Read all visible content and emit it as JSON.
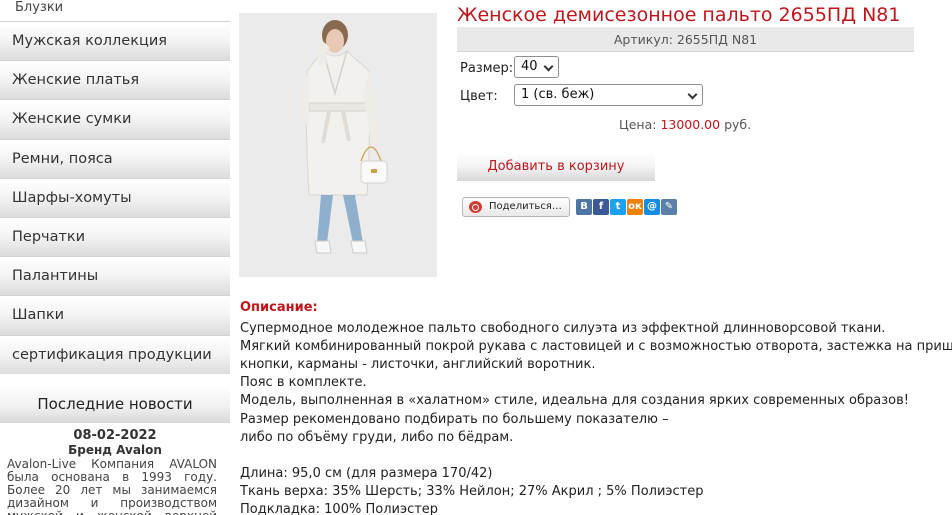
{
  "sidebar": {
    "prev_item": "Блузки",
    "items": [
      {
        "label": "Мужская коллекция"
      },
      {
        "label": "Женские платья"
      },
      {
        "label": "Женские сумки"
      },
      {
        "label": "Ремни, пояса"
      },
      {
        "label": "Шарфы-хомуты"
      },
      {
        "label": "Перчатки"
      },
      {
        "label": "Палантины"
      },
      {
        "label": "Шапки"
      },
      {
        "label": "сертификация продукции"
      }
    ],
    "news": {
      "heading": "Последние новости",
      "date": "08-02-2022",
      "title": "Бренд Avalon",
      "text": "Avalon-Live Компания AVALON была основана в 1993 году. Более 20 лет мы занимаемся дизайном и производством мужской и женской верхней одежды."
    }
  },
  "product": {
    "title": "Женское демисезонное пальто 2655ПД N81",
    "sku": "Артикул: 2655ПД N81",
    "size_label": "Размер:",
    "size_value": "40",
    "color_label": "Цвет:",
    "color_value": "1 (св. беж)",
    "price_label": "Цена:",
    "price_value": "13000.00",
    "price_currency": "руб.",
    "cart_button": "Добавить в корзину",
    "share_button": "Поделиться…",
    "social_icons": [
      {
        "name": "vk-icon",
        "glyph": "В",
        "color": "#4c75a3"
      },
      {
        "name": "facebook-icon",
        "glyph": "f",
        "color": "#3b5998"
      },
      {
        "name": "twitter-icon",
        "glyph": "t",
        "color": "#1da1f2"
      },
      {
        "name": "odnoklassniki-icon",
        "glyph": "ок",
        "color": "#ee8208"
      },
      {
        "name": "mail-icon",
        "glyph": "@",
        "color": "#168de2"
      },
      {
        "name": "livejournal-icon",
        "glyph": "✎",
        "color": "#5a7fa8"
      }
    ]
  },
  "description": {
    "heading": "Описание:",
    "lines": [
      "Супермодное молодежное пальто свободного силуэта из эффектной длинноворсовой ткани.",
      "Мягкий комбинированный покрой рукава с ластовицей и с возможностью отворота, застежка на пришивные",
      "кнопки, карманы - листочки, английский воротник.",
      "Пояс в комплекте.",
      "Модель, выполненная в «халатном» стиле, идеальна для создания ярких современных образов!",
      "Размер рекомендовано подбирать по большему показателю –",
      "либо по объёму груди, либо по бёдрам.",
      "",
      "Длина: 95,0 см (для размера 170/42)",
      "Ткань верха: 35% Шерсть; 33% Нейлон; 27% Акрил ; 5% Полиэстер",
      "Подкладка: 100% Полиэстер"
    ]
  }
}
